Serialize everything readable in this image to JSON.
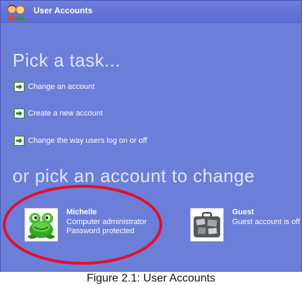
{
  "window": {
    "title": "User Accounts"
  },
  "tasks": {
    "heading": "Pick a task...",
    "items": [
      {
        "label": "Change an account"
      },
      {
        "label": "Create a new account"
      },
      {
        "label": "Change the way users log on or off"
      }
    ]
  },
  "accounts": {
    "heading": "or pick an account to change",
    "items": [
      {
        "name": "Michelle",
        "line1": "Computer administrator",
        "line2": "Password protected",
        "icon": "frog-icon"
      },
      {
        "name": "Guest",
        "line1": "Guest account is off",
        "line2": "",
        "icon": "suitcase-icon"
      }
    ]
  },
  "caption": "Figure 2.1: User Accounts",
  "colors": {
    "window_bg": "#6b7fd8",
    "arrow_green": "#2f7a2f",
    "highlight_ring": "#e0102a"
  }
}
